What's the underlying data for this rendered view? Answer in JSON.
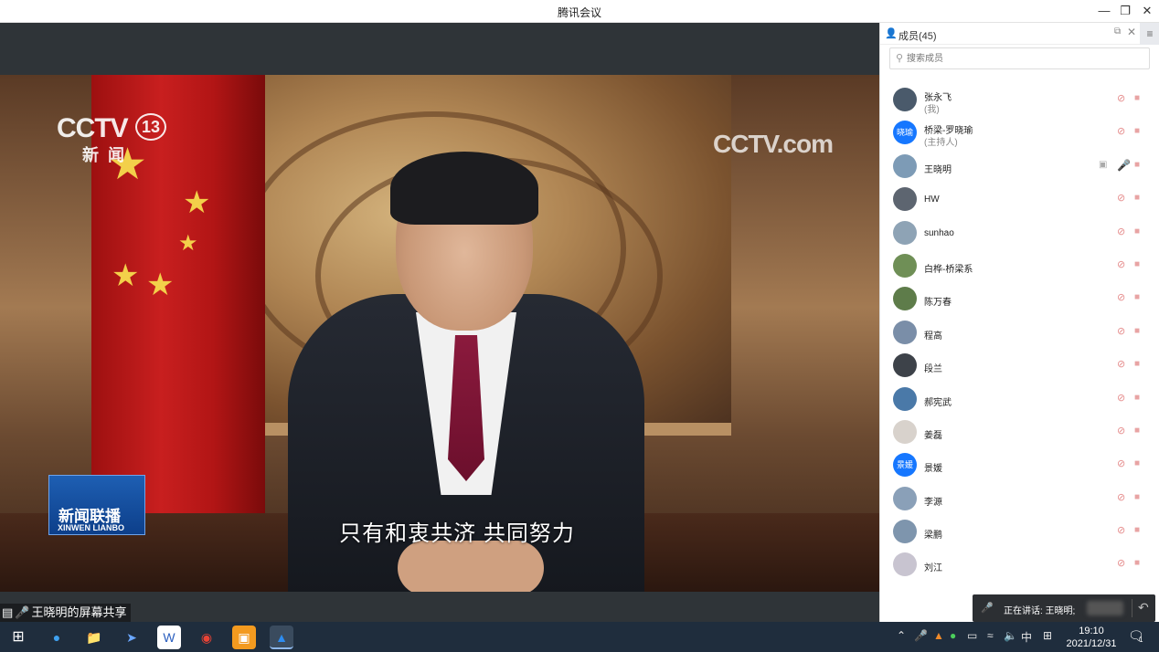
{
  "window": {
    "title": "腾讯会议"
  },
  "video": {
    "channel_logo": "CCTV",
    "channel_number": "13",
    "channel_sub": "新闻",
    "corner_logo": "CCTV.com",
    "program_badge": "新闻联播",
    "program_badge_en": "XINWEN LIANBO",
    "subtitle": "只有和衷共济 共同努力"
  },
  "share_label": "王晓明的屏幕共享",
  "panel": {
    "title": "成员(45)",
    "search_placeholder": "搜索成员",
    "members": [
      {
        "name": "张永飞",
        "role": "(我)",
        "avatar_color": "#4a5a6b",
        "avatar_text": ""
      },
      {
        "name": "桥梁-罗晓瑜",
        "role": "(主持人)",
        "avatar_color": "#1677ff",
        "avatar_text": "晓瑜"
      },
      {
        "name": "王晓明",
        "role": "",
        "avatar_color": "#7d9bb6",
        "avatar_text": "",
        "speaking": true
      },
      {
        "name": "HW",
        "role": "",
        "avatar_color": "#5d6570",
        "avatar_text": ""
      },
      {
        "name": "sunhao",
        "role": "",
        "avatar_color": "#8ea3b5",
        "avatar_text": ""
      },
      {
        "name": "白桦-桥梁系",
        "role": "",
        "avatar_color": "#6f8f56",
        "avatar_text": ""
      },
      {
        "name": "陈万春",
        "role": "",
        "avatar_color": "#5e7c4a",
        "avatar_text": ""
      },
      {
        "name": "程高",
        "role": "",
        "avatar_color": "#7a8ea8",
        "avatar_text": ""
      },
      {
        "name": "段兰",
        "role": "",
        "avatar_color": "#3d4249",
        "avatar_text": ""
      },
      {
        "name": "郝宪武",
        "role": "",
        "avatar_color": "#4a79a8",
        "avatar_text": ""
      },
      {
        "name": "姜磊",
        "role": "",
        "avatar_color": "#d8d2cc",
        "avatar_text": ""
      },
      {
        "name": "景媛",
        "role": "",
        "avatar_color": "#1677ff",
        "avatar_text": "景媛"
      },
      {
        "name": "李源",
        "role": "",
        "avatar_color": "#8aa0b8",
        "avatar_text": ""
      },
      {
        "name": "梁鹏",
        "role": "",
        "avatar_color": "#7e95ad",
        "avatar_text": ""
      },
      {
        "name": "刘江",
        "role": "",
        "avatar_color": "#c8c4d0",
        "avatar_text": ""
      }
    ]
  },
  "speaking_bar": {
    "text": "正在讲话: 王晓明;"
  },
  "taskbar": {
    "ime": "中",
    "time": "19:10",
    "date": "2021/12/31",
    "notifications": "1"
  }
}
